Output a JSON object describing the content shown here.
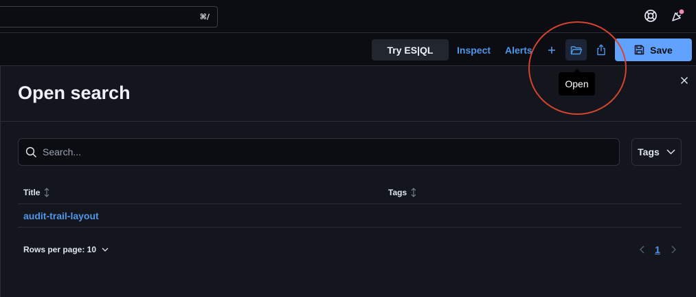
{
  "header": {
    "search_shortcut": "⌘/",
    "icons": [
      "help-icon",
      "newsfeed-icon"
    ],
    "notification_dot_color": "#f08bb5"
  },
  "toolbar": {
    "try_esql_label": "Try ES|QL",
    "inspect_label": "Inspect",
    "alerts_label": "Alerts",
    "new_icon": "plus-icon",
    "open_icon": "folder-open-icon",
    "share_icon": "share-icon",
    "save_label": "Save",
    "save_color": "#61a2ff"
  },
  "tooltip": {
    "text": "Open"
  },
  "annotation": {
    "color": "#d6442f"
  },
  "flyout": {
    "title": "Open search",
    "search_placeholder": "Search...",
    "tags_filter_label": "Tags",
    "table": {
      "columns": [
        "Title",
        "Tags"
      ],
      "rows": [
        {
          "title": "audit-trail-layout",
          "tags": ""
        }
      ]
    },
    "pagination": {
      "rows_per_page": "Rows per page: 10",
      "current_page": "1"
    }
  }
}
